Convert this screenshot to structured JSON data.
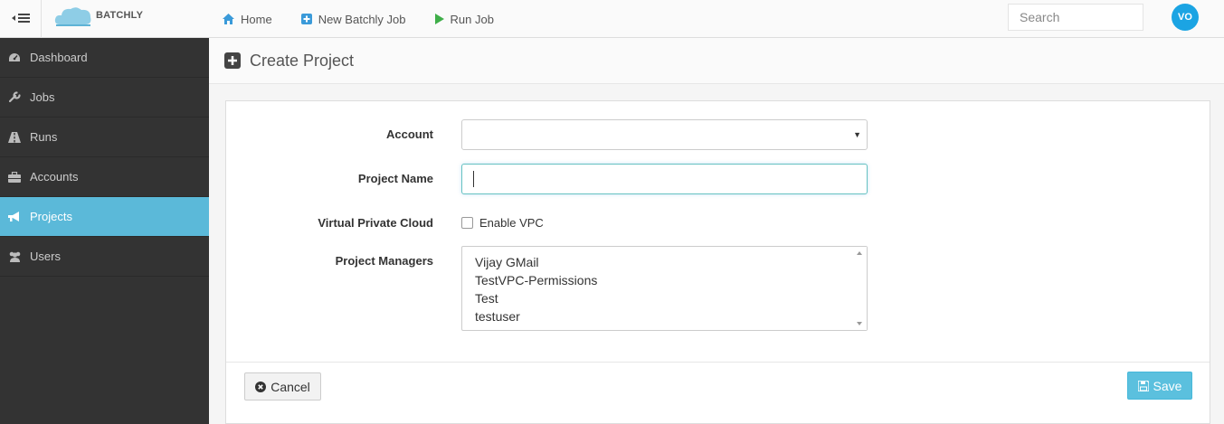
{
  "app": {
    "brand": "BATCHLY"
  },
  "topnav": {
    "items": [
      {
        "label": "Home",
        "icon": "home-icon"
      },
      {
        "label": "New Batchly Job",
        "icon": "plus-square-icon"
      },
      {
        "label": "Run Job",
        "icon": "play-icon"
      }
    ],
    "search_placeholder": "Search",
    "user_initials": "VO"
  },
  "sidebar": {
    "items": [
      {
        "label": "Dashboard",
        "icon": "dashboard-icon",
        "active": false
      },
      {
        "label": "Jobs",
        "icon": "wrench-icon",
        "active": false
      },
      {
        "label": "Runs",
        "icon": "road-icon",
        "active": false
      },
      {
        "label": "Accounts",
        "icon": "briefcase-icon",
        "active": false
      },
      {
        "label": "Projects",
        "icon": "bullhorn-icon",
        "active": true
      },
      {
        "label": "Users",
        "icon": "users-icon",
        "active": false
      }
    ]
  },
  "page": {
    "title": "Create Project"
  },
  "form": {
    "account_label": "Account",
    "account_value": "",
    "project_name_label": "Project Name",
    "project_name_value": "",
    "vpc_label": "Virtual Private Cloud",
    "vpc_checkbox_label": "Enable VPC",
    "vpc_enabled": false,
    "managers_label": "Project Managers",
    "managers_options": [
      "Vijay GMail",
      "TestVPC-Permissions",
      "Test",
      "testuser"
    ]
  },
  "footer": {
    "cancel_label": "Cancel",
    "save_label": "Save"
  },
  "colors": {
    "accent": "#5bc0de",
    "sidebar_bg": "#333333",
    "sidebar_active": "#5bb9d9",
    "avatar": "#1ba4e3"
  }
}
